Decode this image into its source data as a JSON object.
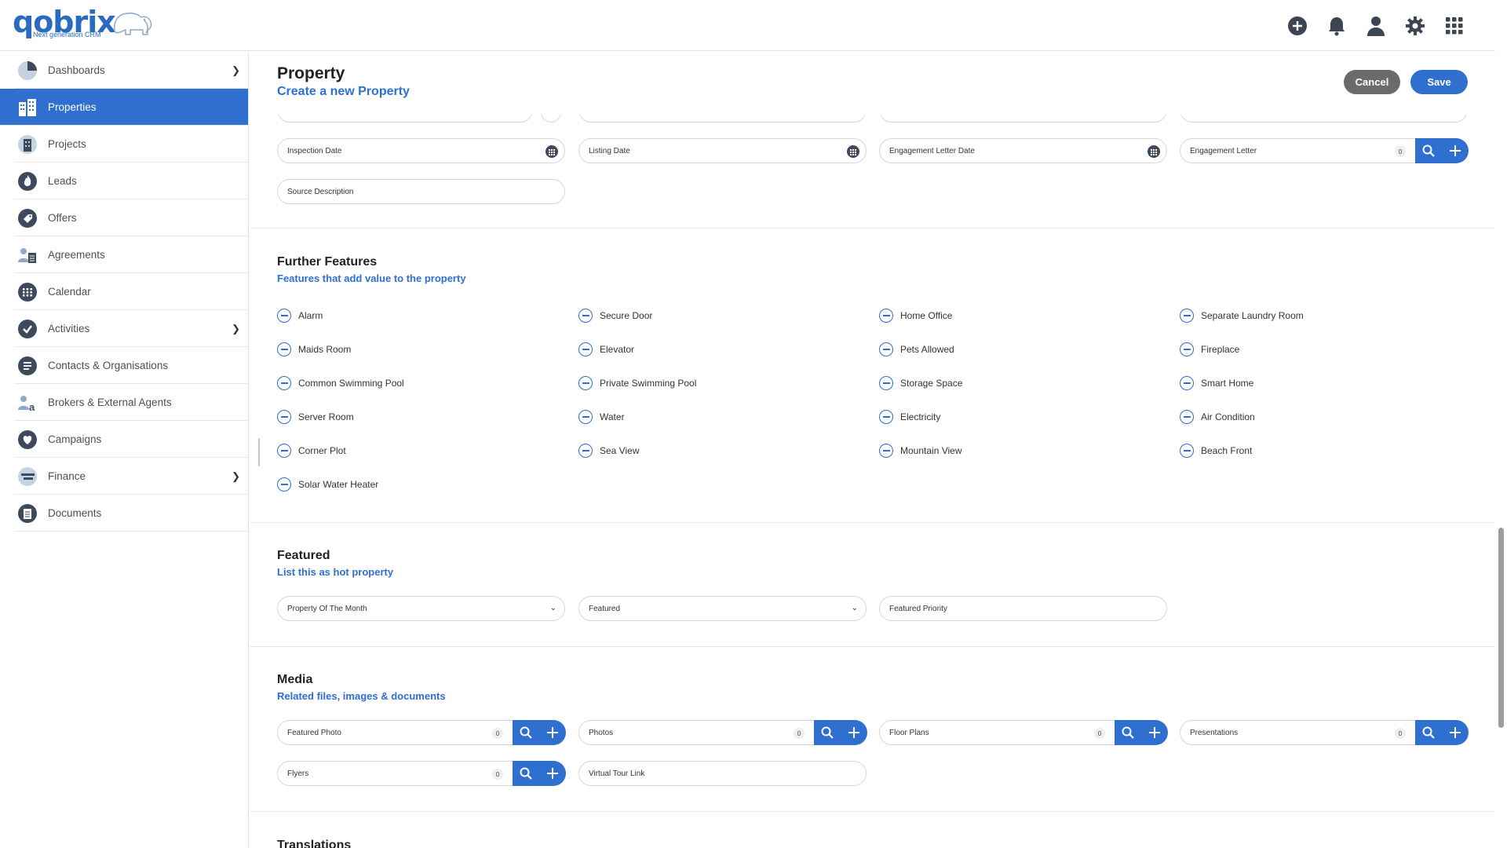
{
  "app": {
    "logo_text": "qobrix",
    "logo_tagline": "Next generation CRM"
  },
  "header_icons": [
    "add-icon",
    "bell-icon",
    "user-icon",
    "gear-icon",
    "apps-grid-icon"
  ],
  "sidebar": {
    "items": [
      {
        "label": "Dashboards",
        "icon": "pie-chart-icon",
        "has_children": true
      },
      {
        "label": "Properties",
        "icon": "building-icon",
        "active": true
      },
      {
        "label": "Projects",
        "icon": "projects-icon"
      },
      {
        "label": "Leads",
        "icon": "flame-icon"
      },
      {
        "label": "Offers",
        "icon": "tag-icon"
      },
      {
        "label": "Agreements",
        "icon": "agreements-icon"
      },
      {
        "label": "Calendar",
        "icon": "calendar-icon"
      },
      {
        "label": "Activities",
        "icon": "check-circle-icon",
        "has_children": true
      },
      {
        "label": "Contacts & Organisations",
        "icon": "contacts-icon"
      },
      {
        "label": "Brokers & External Agents",
        "icon": "broker-icon"
      },
      {
        "label": "Campaigns",
        "icon": "heart-icon"
      },
      {
        "label": "Finance",
        "icon": "finance-icon",
        "has_children": true
      },
      {
        "label": "Documents",
        "icon": "documents-icon"
      }
    ]
  },
  "page": {
    "title": "Property",
    "subtitle": "Create a new Property",
    "cancel_label": "Cancel",
    "save_label": "Save"
  },
  "dates": {
    "inspection_date": "Inspection Date",
    "listing_date": "Listing Date",
    "engagement_letter_date": "Engagement Letter Date",
    "engagement_letter": "Engagement Letter",
    "engagement_letter_count": "0",
    "source_description": "Source Description"
  },
  "further_features": {
    "title": "Further Features",
    "subtitle": "Features that add value to the property",
    "items": [
      "Alarm",
      "Secure Door",
      "Home Office",
      "Separate Laundry Room",
      "Maids Room",
      "Elevator",
      "Pets Allowed",
      "Fireplace",
      "Common Swimming Pool",
      "Private Swimming Pool",
      "Storage Space",
      "Smart Home",
      "Server Room",
      "Water",
      "Electricity",
      "Air Condition",
      "Corner Plot",
      "Sea View",
      "Mountain View",
      "Beach Front",
      "Solar Water Heater"
    ]
  },
  "featured": {
    "title": "Featured",
    "subtitle": "List this as hot property",
    "property_of_month": "Property Of The Month",
    "featured": "Featured",
    "featured_priority": "Featured Priority"
  },
  "media": {
    "title": "Media",
    "subtitle": "Related files, images & documents",
    "featured_photo": "Featured Photo",
    "photos": "Photos",
    "floor_plans": "Floor Plans",
    "presentations": "Presentations",
    "flyers": "Flyers",
    "virtual_tour_link": "Virtual Tour Link",
    "count": "0"
  },
  "translations": {
    "title": "Translations"
  }
}
